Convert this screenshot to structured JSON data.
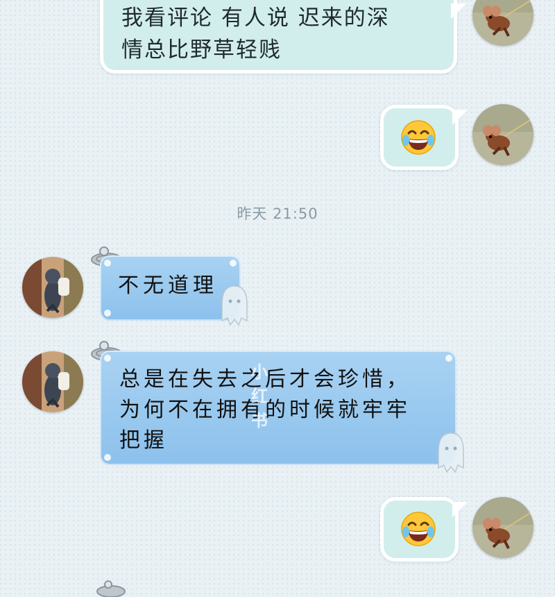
{
  "messages": [
    {
      "id": "m1",
      "sender": "self",
      "text": "我看评论 有人说 迟来的深情总比野草轻贱",
      "line1": "我看评论 有人说 迟来的深",
      "line2": "情总比野草轻贱"
    },
    {
      "id": "m2",
      "sender": "self",
      "emoji": "tears-of-joy-emoji"
    },
    {
      "id": "m3",
      "sender": "other",
      "text": "不无道理"
    },
    {
      "id": "m4",
      "sender": "other",
      "line1": "总是在失去之后才会珍惜，",
      "line2": "为何不在拥有的时候就牢牢",
      "line3": "把握"
    },
    {
      "id": "m5",
      "sender": "self",
      "emoji": "tears-of-joy-emoji"
    }
  ],
  "timestamp": "昨天 21:50",
  "watermark": "小红书",
  "colors": {
    "self_bubble": "#d2eeec",
    "other_bubble": "#9ccaf0",
    "timestamp": "#8a9aa3",
    "background": "#e9f1f5"
  },
  "icons": {
    "self_avatar": "jerry-mouse-avatar",
    "other_avatar": "tom-cat-avatar",
    "clip": "paper-clip-icon",
    "ghost": "ghost-doll-icon"
  }
}
